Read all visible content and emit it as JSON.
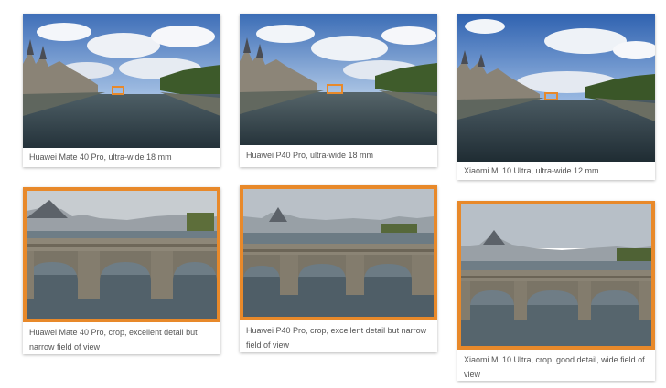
{
  "colors": {
    "accent": "#e8892a",
    "caption_text": "#555555"
  },
  "cards": [
    {
      "caption": "Huawei Mate 40 Pro, ultra-wide 18 mm",
      "kind": "ultra-wide photo"
    },
    {
      "caption": "Huawei P40 Pro, ultra-wide 18 mm",
      "kind": "ultra-wide photo"
    },
    {
      "caption": "Xiaomi Mi 10 Ultra, ultra-wide 12 mm",
      "kind": "ultra-wide photo"
    },
    {
      "caption": "Huawei Mate 40 Pro, crop, excellent detail but narrow field of view",
      "kind": "crop photo"
    },
    {
      "caption": "Huawei P40 Pro, crop, excellent detail but narrow field of view",
      "kind": "crop photo"
    },
    {
      "caption": "Xiaomi Mi 10 Ultra, crop, good detail, wide field of view",
      "kind": "crop photo"
    }
  ]
}
